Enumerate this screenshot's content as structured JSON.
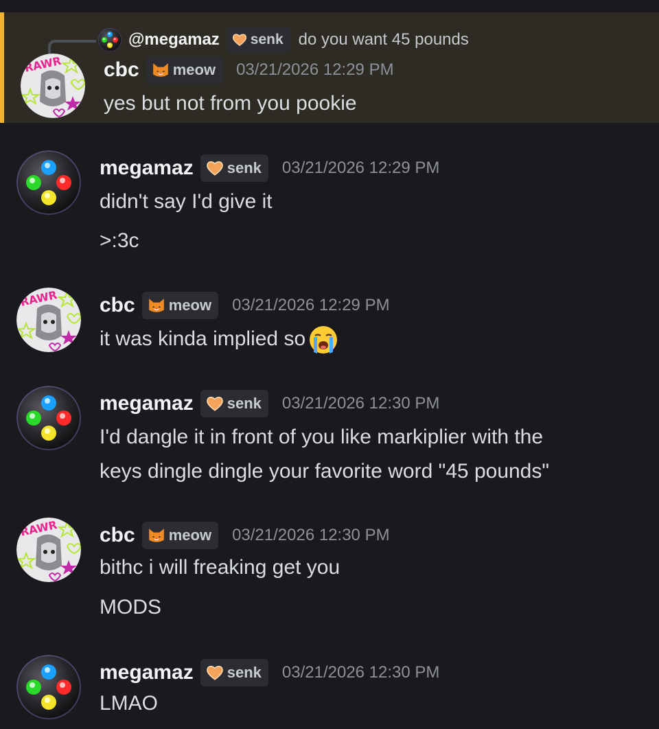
{
  "users": {
    "cbc": {
      "name": "cbc",
      "tag": "meow",
      "tag_icon": "cat-face-icon",
      "avatar": "rawr-stars-avatar"
    },
    "megamaz": {
      "name": "megamaz",
      "tag": "senk",
      "tag_icon": "orange-heart-icon",
      "avatar": "controller-buttons-avatar"
    }
  },
  "reply": {
    "mention": "@megamaz",
    "tag": "senk",
    "text": "do you want 45 pounds"
  },
  "messages": [
    {
      "author": "cbc",
      "tag": "meow",
      "time": "03/21/2026 12:29 PM",
      "lines": [
        "yes but not from you pookie"
      ]
    },
    {
      "author": "megamaz",
      "tag": "senk",
      "time": "03/21/2026 12:29 PM",
      "lines": [
        "didn't say I'd give it",
        ">:3c"
      ]
    },
    {
      "author": "cbc",
      "tag": "meow",
      "time": "03/21/2026 12:29 PM",
      "lines": [
        "it was kinda implied so"
      ],
      "emoji": "loudly-crying-face-icon"
    },
    {
      "author": "megamaz",
      "tag": "senk",
      "time": "03/21/2026 12:30 PM",
      "lines": [
        "I'd dangle it in front of you like markiplier with the",
        "keys dingle dingle your favorite word \"45 pounds\""
      ]
    },
    {
      "author": "cbc",
      "tag": "meow",
      "time": "03/21/2026 12:30 PM",
      "lines": [
        "bithc i will freaking get you",
        "MODS"
      ]
    },
    {
      "author": "megamaz",
      "tag": "senk",
      "time": "03/21/2026 12:30 PM",
      "lines": [
        "LMAO"
      ]
    }
  ],
  "colors": {
    "background": "#1a1a1e",
    "mention_bg": "#2e2b25",
    "mention_bar": "#f0b232",
    "timestamp": "#8d9199"
  }
}
